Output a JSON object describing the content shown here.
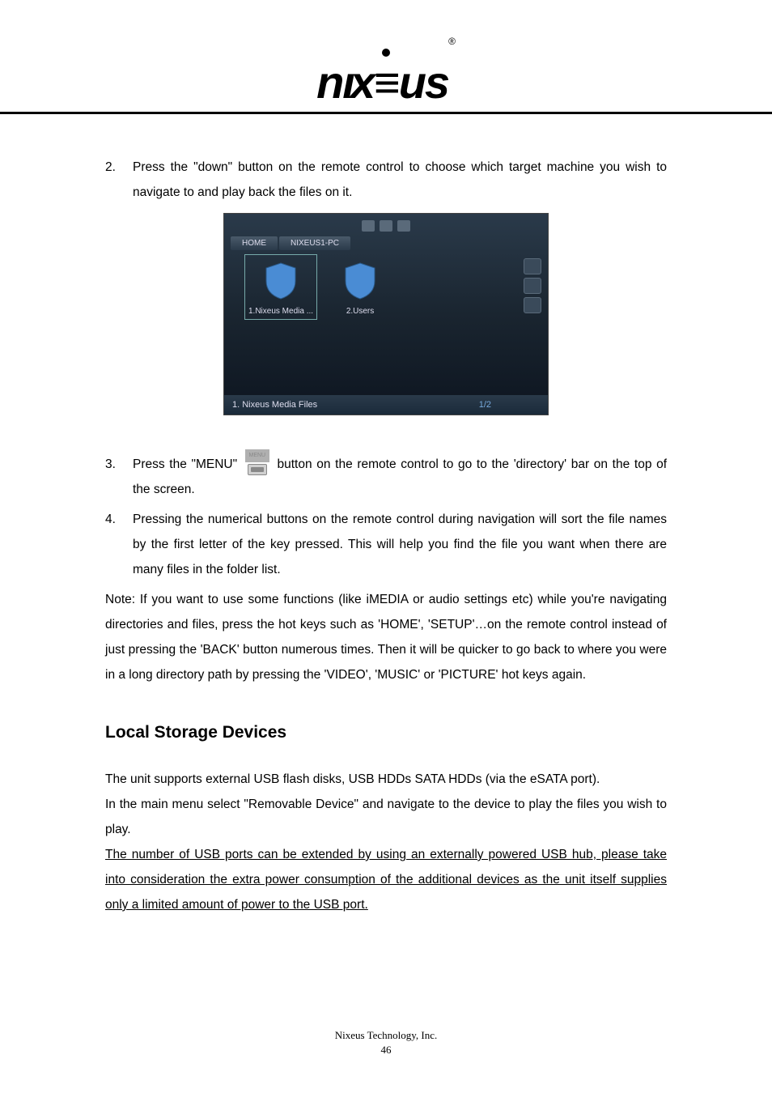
{
  "logo": {
    "text": "nıx≡us",
    "registered": "®"
  },
  "steps": {
    "s2": {
      "num": "2.",
      "text": "Press the \"down\" button on the remote control to choose which target machine you wish to navigate to and play back the files on it."
    },
    "s3": {
      "num": "3.",
      "pre": "Press the \"MENU\"",
      "post": " button on the remote control to go to the 'directory' bar on the top of the screen."
    },
    "s4": {
      "num": "4.",
      "text": "Pressing the numerical buttons on the remote control during navigation will sort the file names by the first letter of the key pressed. This will help you find the file you want when there are many files in the folder list."
    }
  },
  "note": "Note: If you want to use some functions (like iMEDIA or audio settings etc) while you're navigating directories and files, press the hot keys such as 'HOME', 'SETUP'…on the remote control instead of just pressing the 'BACK' button numerous times. Then it will be quicker to go back to where you were in a long directory path by pressing the 'VIDEO', 'MUSIC' or 'PICTURE' hot keys again.",
  "section_heading": "Local Storage Devices",
  "body": {
    "p1": "The unit supports external USB flash disks, USB HDDs SATA HDDs (via the eSATA port).",
    "p2": "In the main menu select \"Removable Device\" and navigate to the device to play the files you wish to play.",
    "p3": "The number of USB ports can be extended by using an externally powered USB hub, please take into consideration the extra power consumption of the additional devices as the unit itself supplies only a limited amount of power to the USB port."
  },
  "screenshot": {
    "breadcrumb": {
      "home": "HOME",
      "path": "NIXEUS1-PC"
    },
    "items": {
      "i1": "1.Nixeus Media ...",
      "i2": "2.Users"
    },
    "bottom": {
      "title": "1. Nixeus Media Files",
      "page": "1/2"
    }
  },
  "menu_button": {
    "label": "MENU"
  },
  "footer": {
    "company": "Nixeus Technology, Inc.",
    "page": "46"
  }
}
